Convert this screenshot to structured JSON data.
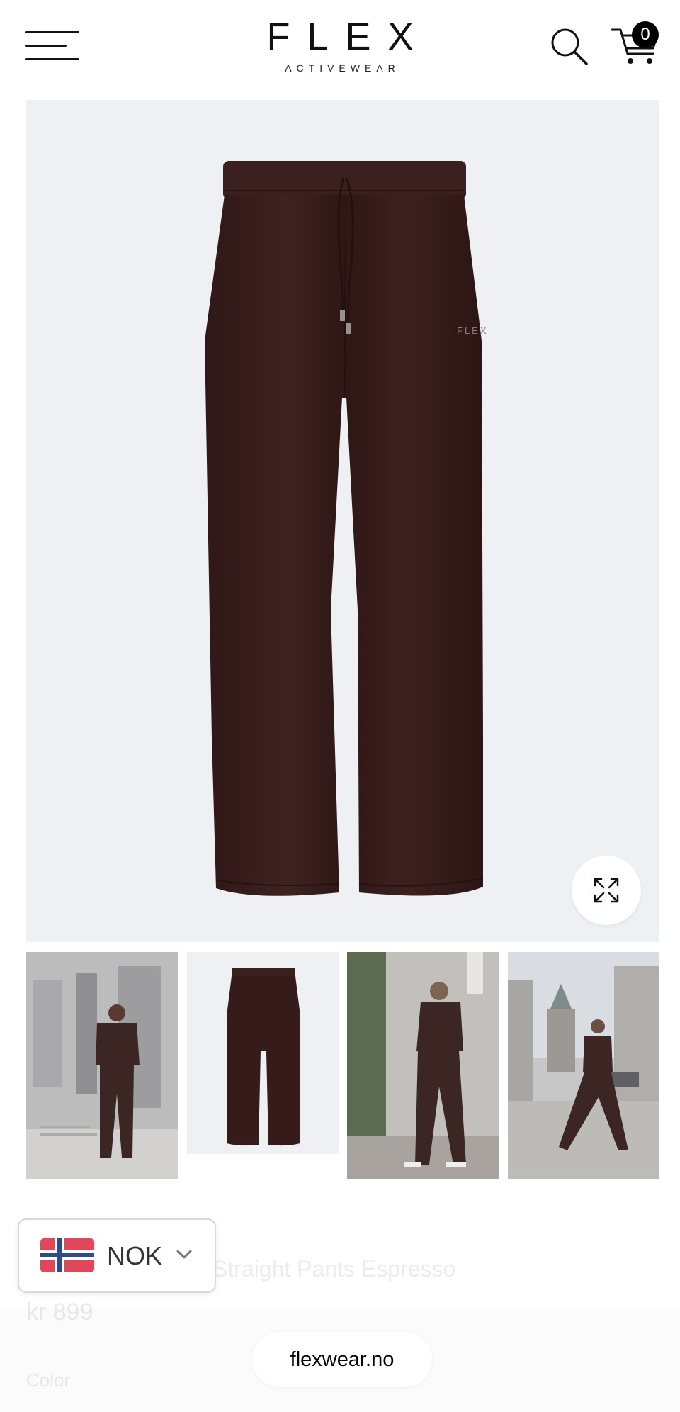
{
  "header": {
    "brand": "FLEX",
    "brand_sub": "ACTIVEWEAR",
    "cart_count": "0"
  },
  "product": {
    "title": "Straight Pants Espresso",
    "price": "kr 899",
    "color_label": "Color",
    "garment_color": "#3a1f1d",
    "background_color": "#eef0f4"
  },
  "thumbnails": [
    {
      "label": "lifestyle-photo-1"
    },
    {
      "label": "product-photo"
    },
    {
      "label": "lifestyle-photo-2"
    },
    {
      "label": "lifestyle-photo-3"
    }
  ],
  "currency": {
    "code": "NOK",
    "flag": "norway-flag-icon"
  },
  "browser": {
    "domain": "flexwear.no"
  }
}
